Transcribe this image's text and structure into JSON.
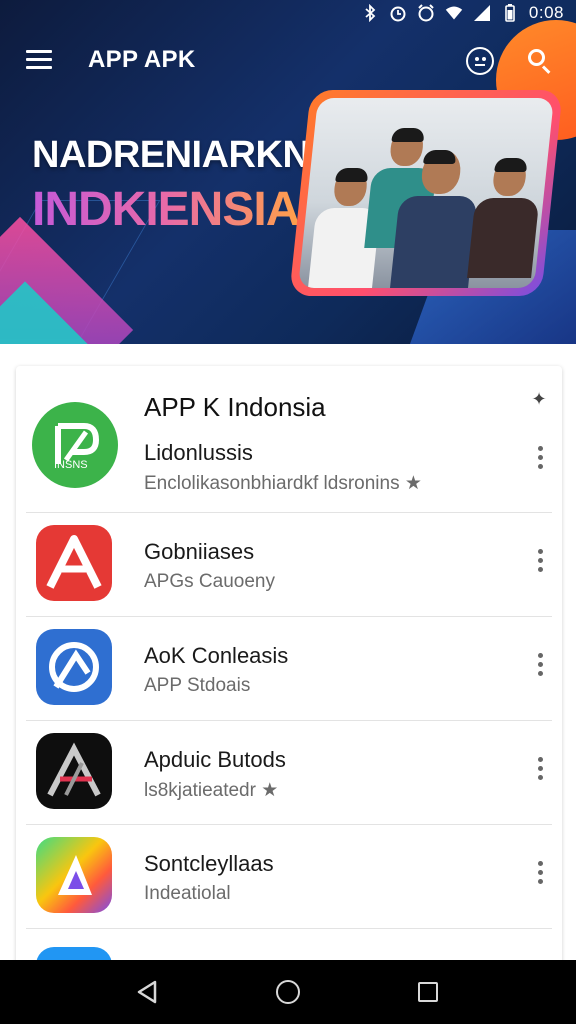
{
  "status_bar": {
    "time": "0:08",
    "icons": [
      "bluetooth-icon",
      "alarm-icon",
      "clock-icon",
      "wifi-icon",
      "signal-icon",
      "battery-icon"
    ]
  },
  "app_bar": {
    "title": "APP APK",
    "icons": [
      "menu-icon",
      "face-icon",
      "search-icon"
    ]
  },
  "hero": {
    "line1": "NADRENIARKNAN",
    "line2": "INDKIENSIA"
  },
  "card": {
    "title": "APP K Indonsia",
    "items": [
      {
        "name": "Lidonlussis",
        "subtitle": "Enclolikasonbhiardkf ldsronins ★",
        "icon": "green-app-icon",
        "icon_text": "INSNS"
      },
      {
        "name": "Gobniiases",
        "subtitle": "APGs Cauoeny",
        "icon": "red-app-icon"
      },
      {
        "name": "AoK Conleasis",
        "subtitle": "APP Stdoais",
        "icon": "blue-app-icon"
      },
      {
        "name": "Apduic Butods",
        "subtitle": "ls8kjatieatedr ★",
        "icon": "black-app-icon"
      },
      {
        "name": "Sontcleyllaas",
        "subtitle": "Indeatiolal",
        "icon": "gradient-app-icon"
      },
      {
        "name": "...",
        "subtitle": "",
        "icon": "partial-app-icon"
      }
    ]
  },
  "colors": {
    "hero_bg": "#14306a",
    "accent_orange": "#ff6a2a",
    "accent_pink": "#e86aa8",
    "card_bg": "#ffffff",
    "navbar_bg": "#000000"
  },
  "nav_bar": {
    "icons": [
      "back-icon",
      "home-icon",
      "recents-icon"
    ]
  }
}
